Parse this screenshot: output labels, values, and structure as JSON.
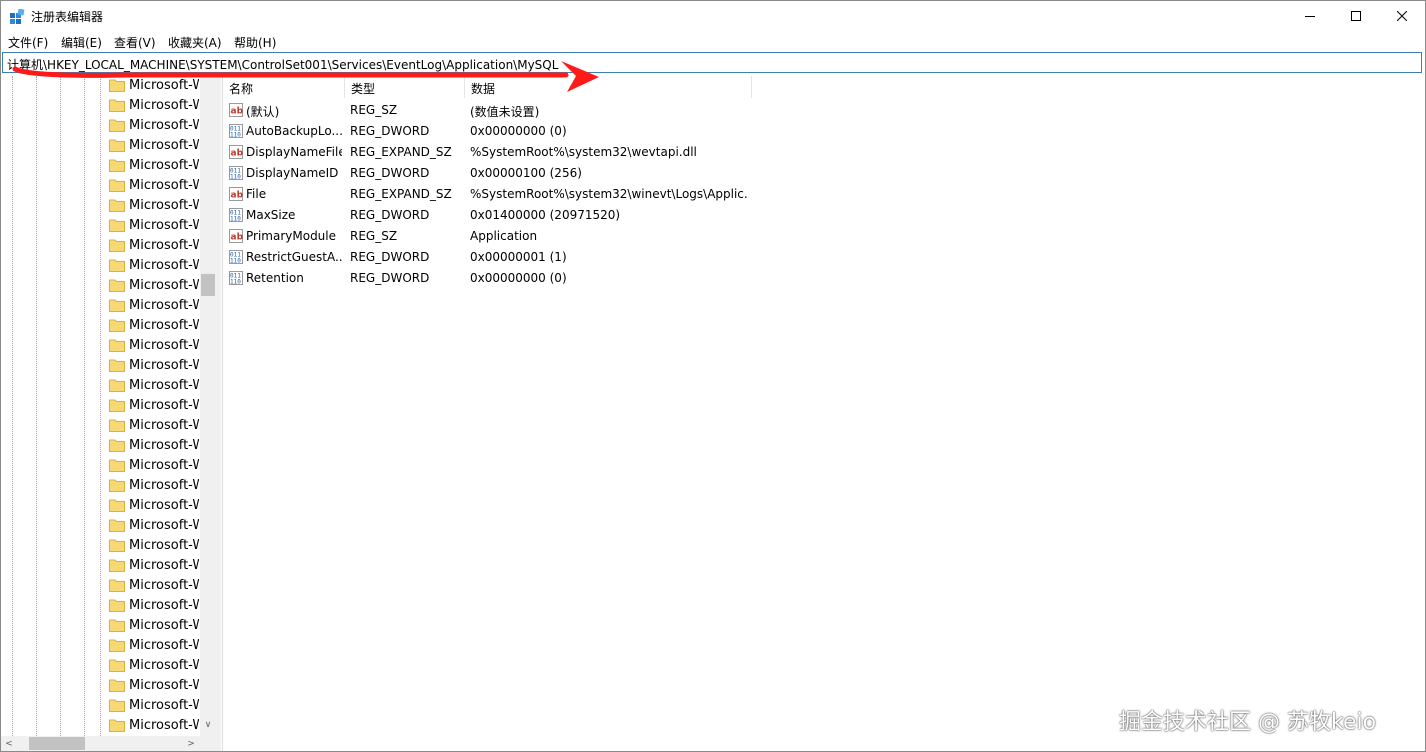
{
  "window": {
    "title": "注册表编辑器"
  },
  "menu": [
    "文件(F)",
    "编辑(E)",
    "查看(V)",
    "收藏夹(A)",
    "帮助(H)"
  ],
  "address": {
    "path": "计算机\\HKEY_LOCAL_MACHINE\\SYSTEM\\ControlSet001\\Services\\EventLog\\Application\\MySQL"
  },
  "tree": {
    "items": [
      "Microsoft-W",
      "Microsoft-W",
      "Microsoft-W",
      "Microsoft-W",
      "Microsoft-W",
      "Microsoft-W",
      "Microsoft-W",
      "Microsoft-W",
      "Microsoft-W",
      "Microsoft-W",
      "Microsoft-W",
      "Microsoft-W",
      "Microsoft-W",
      "Microsoft-W",
      "Microsoft-W",
      "Microsoft-W",
      "Microsoft-W",
      "Microsoft-W",
      "Microsoft-W",
      "Microsoft-W",
      "Microsoft-W",
      "Microsoft-W",
      "Microsoft-W",
      "Microsoft-W",
      "Microsoft-W",
      "Microsoft-W",
      "Microsoft-W",
      "Microsoft-W",
      "Microsoft-W",
      "Microsoft-W",
      "Microsoft-W",
      "Microsoft-W",
      "Microsoft-W"
    ]
  },
  "values": {
    "columns": [
      "名称",
      "类型",
      "数据"
    ],
    "rows": [
      {
        "icon": "string-value-icon",
        "name": "(默认)",
        "type": "REG_SZ",
        "data": "(数值未设置)"
      },
      {
        "icon": "binary-value-icon",
        "name": "AutoBackupLo...",
        "type": "REG_DWORD",
        "data": "0x00000000 (0)"
      },
      {
        "icon": "string-value-icon",
        "name": "DisplayNameFile",
        "type": "REG_EXPAND_SZ",
        "data": "%SystemRoot%\\system32\\wevtapi.dll"
      },
      {
        "icon": "binary-value-icon",
        "name": "DisplayNameID",
        "type": "REG_DWORD",
        "data": "0x00000100 (256)"
      },
      {
        "icon": "string-value-icon",
        "name": "File",
        "type": "REG_EXPAND_SZ",
        "data": "%SystemRoot%\\system32\\winevt\\Logs\\Applic..."
      },
      {
        "icon": "binary-value-icon",
        "name": "MaxSize",
        "type": "REG_DWORD",
        "data": "0x01400000 (20971520)"
      },
      {
        "icon": "string-value-icon",
        "name": "PrimaryModule",
        "type": "REG_SZ",
        "data": "Application"
      },
      {
        "icon": "binary-value-icon",
        "name": "RestrictGuestA...",
        "type": "REG_DWORD",
        "data": "0x00000001 (1)"
      },
      {
        "icon": "binary-value-icon",
        "name": "Retention",
        "type": "REG_DWORD",
        "data": "0x00000000 (0)"
      }
    ]
  },
  "colors": {
    "annotation_arrow": "#ff1a1a",
    "address_border": "#3c7fb1",
    "folder": "#f8d775"
  },
  "watermark": "掘金技术社区 @ 苏牧keio"
}
